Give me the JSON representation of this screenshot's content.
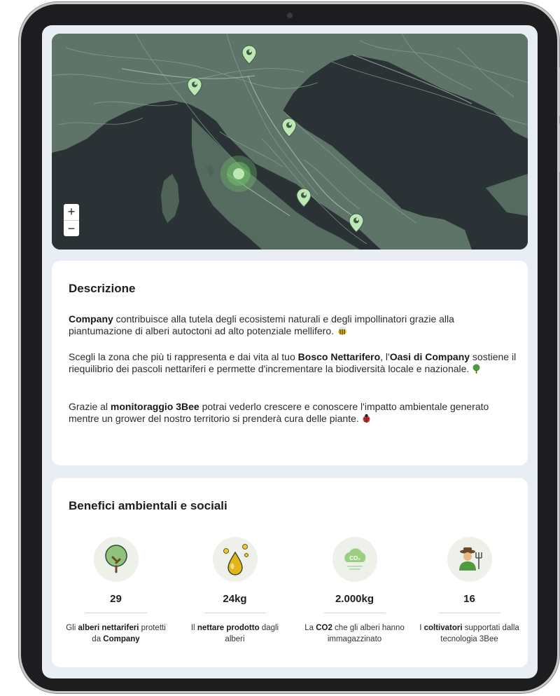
{
  "map": {
    "zoom_in": "+",
    "zoom_out": "−",
    "pins": [
      "pin-north-1",
      "pin-north-2",
      "pin-adriatic",
      "pin-central",
      "pin-south",
      "pin-selected"
    ]
  },
  "description": {
    "title": "Descrizione",
    "p1_bold": "Company",
    "p1_rest": " contribuisce alla tutela degli ecosistemi naturali e degli impollinatori grazie alla piantumazione di alberi autoctoni ad alto potenziale mellifero.",
    "p2_a": "Scegli la zona che più ti rappresenta e dai vita al tuo ",
    "p2_bold1": "Bosco Nettarifero",
    "p2_b": ", l'",
    "p2_bold2": "Oasi di Company",
    "p2_c": " sostiene il riequilibrio dei pascoli nettariferi e permette d'incrementare la biodiversità locale e nazionale.",
    "p3_a": "Grazie al ",
    "p3_bold": "monitoraggio 3Bee",
    "p3_b": " potrai vederlo crescere e conoscere l'impatto ambientale generato mentre un grower del nostro territorio si prenderà cura delle piante."
  },
  "benefits": {
    "title": "Benefici ambientali e sociali",
    "items": [
      {
        "icon": "tree-icon",
        "value": "29",
        "cap_a": "Gli ",
        "cap_bold": "alberi nettariferi",
        "cap_b": " protetti da ",
        "cap_bold2": "Company",
        "cap_c": ""
      },
      {
        "icon": "nectar-drop-icon",
        "value": "24kg",
        "cap_a": "Il ",
        "cap_bold": "nettare prodotto",
        "cap_b": " dagli alberi",
        "cap_bold2": "",
        "cap_c": ""
      },
      {
        "icon": "co2-cloud-icon",
        "value": "2.000kg",
        "cap_a": "La ",
        "cap_bold": "CO2",
        "cap_b": " che gli alberi hanno immagazzinato",
        "cap_bold2": "",
        "cap_c": ""
      },
      {
        "icon": "farmer-icon",
        "value": "16",
        "cap_a": "I ",
        "cap_bold": "coltivatori",
        "cap_b": " supportati dalla tecnologia 3Bee",
        "cap_bold2": "",
        "cap_c": ""
      }
    ]
  },
  "colors": {
    "sea": "#2a3236",
    "land": "#5e7468",
    "pin": "#bde7b4",
    "accent": "#6fbf6a"
  }
}
